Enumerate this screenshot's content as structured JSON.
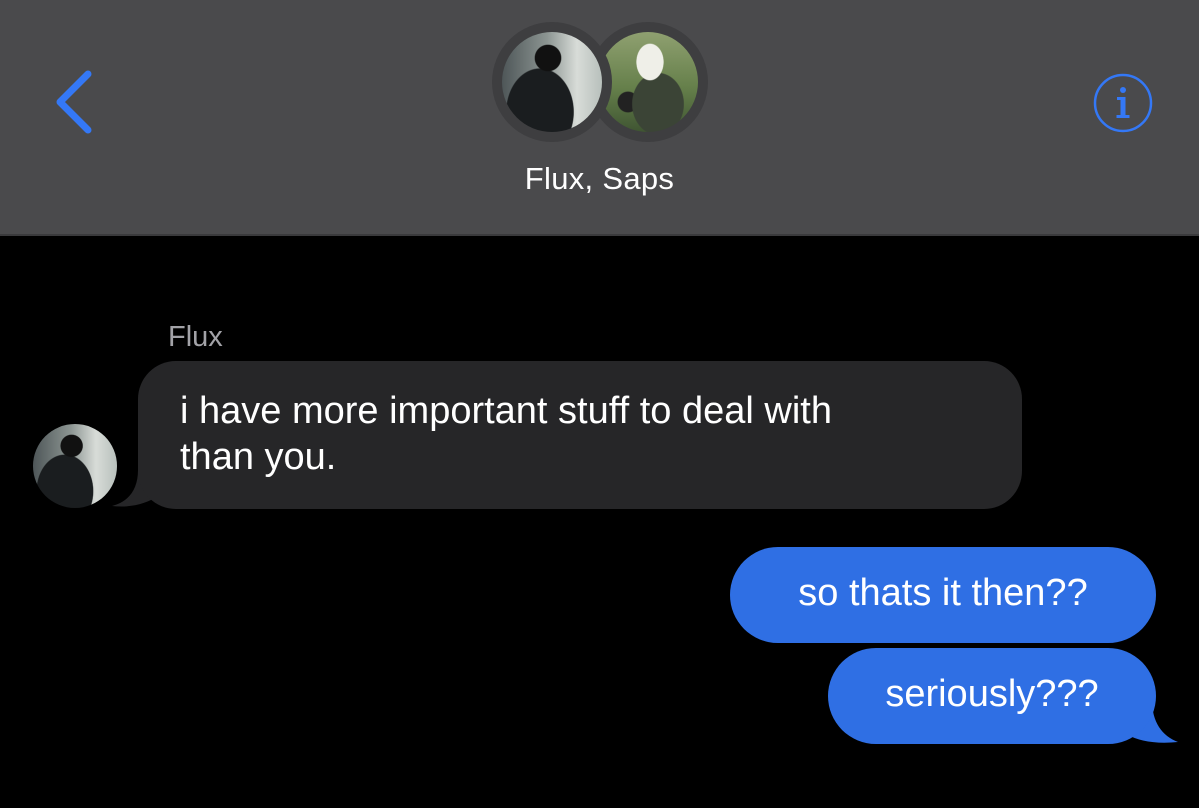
{
  "header": {
    "group_name": "Flux, Saps",
    "participants": [
      "Flux",
      "Saps"
    ],
    "back_icon": "chevron-left-icon",
    "info_icon": "info-icon",
    "accent_color": "#3478f6"
  },
  "conversation": {
    "incoming": {
      "sender": "Flux",
      "text_lines": [
        "i have more important stuff to deal with",
        "than you."
      ],
      "bubble_color": "#262628"
    },
    "outgoing": [
      {
        "text": "so thats it then??"
      },
      {
        "text": "seriously???"
      }
    ],
    "outgoing_bubble_color": "#2f6fe4"
  }
}
